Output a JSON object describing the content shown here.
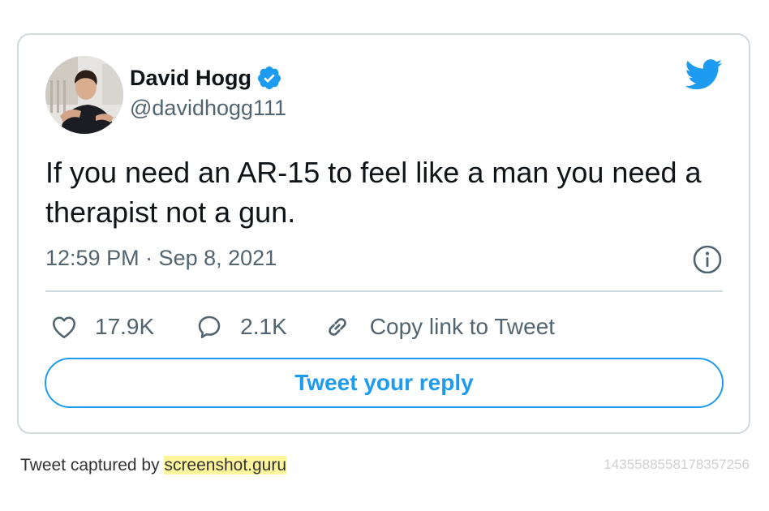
{
  "author": {
    "display_name": "David Hogg",
    "handle": "@davidhogg111",
    "verified": true
  },
  "tweet": {
    "text": "If you need an AR-15 to feel like a man you need a therapist not a gun.",
    "timestamp": "12:59 PM · Sep 8, 2021"
  },
  "actions": {
    "likes": "17.9K",
    "replies": "2.1K",
    "copy_link": "Copy link to Tweet"
  },
  "reply_button": "Tweet your reply",
  "footer": {
    "captured_prefix": "Tweet captured by ",
    "captured_site": "screenshot.guru",
    "tweet_id": "1435588558178357256"
  },
  "icons": {
    "brand": "twitter-bird-icon",
    "verified": "verified-badge-icon",
    "info": "info-icon",
    "like": "heart-icon",
    "reply": "speech-bubble-icon",
    "copy": "link-icon"
  },
  "colors": {
    "accent": "#1d9bf0",
    "text": "#0f1419",
    "secondary": "#536471",
    "border": "#cfd9de",
    "highlight": "#fff59d"
  }
}
